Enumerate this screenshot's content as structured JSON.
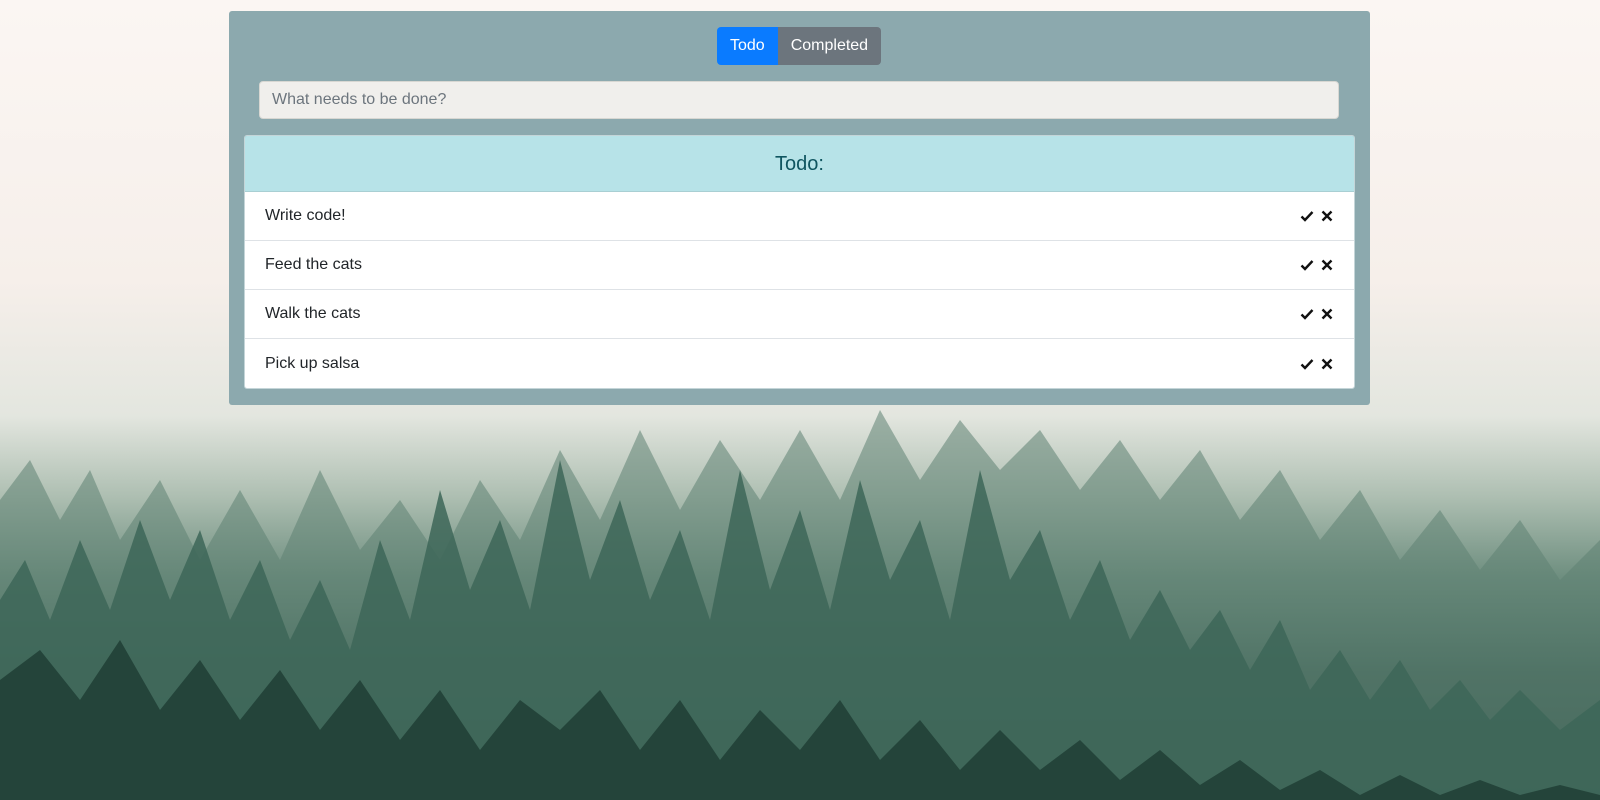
{
  "tabs": [
    {
      "label": "Todo",
      "active": true
    },
    {
      "label": "Completed",
      "active": false
    }
  ],
  "input": {
    "placeholder": "What needs to be done?",
    "value": ""
  },
  "list": {
    "header": "Todo:",
    "items": [
      {
        "label": "Write code!"
      },
      {
        "label": "Feed the cats"
      },
      {
        "label": "Walk the cats"
      },
      {
        "label": "Pick up salsa"
      }
    ]
  },
  "colors": {
    "card_bg": "#8ca9ae",
    "active_tab": "#0a7bff",
    "inactive_tab": "#6c757d",
    "list_header_bg": "#b7e3e8",
    "list_header_text": "#0f5560"
  },
  "icons": {
    "complete": "check-icon",
    "delete": "close-icon"
  }
}
